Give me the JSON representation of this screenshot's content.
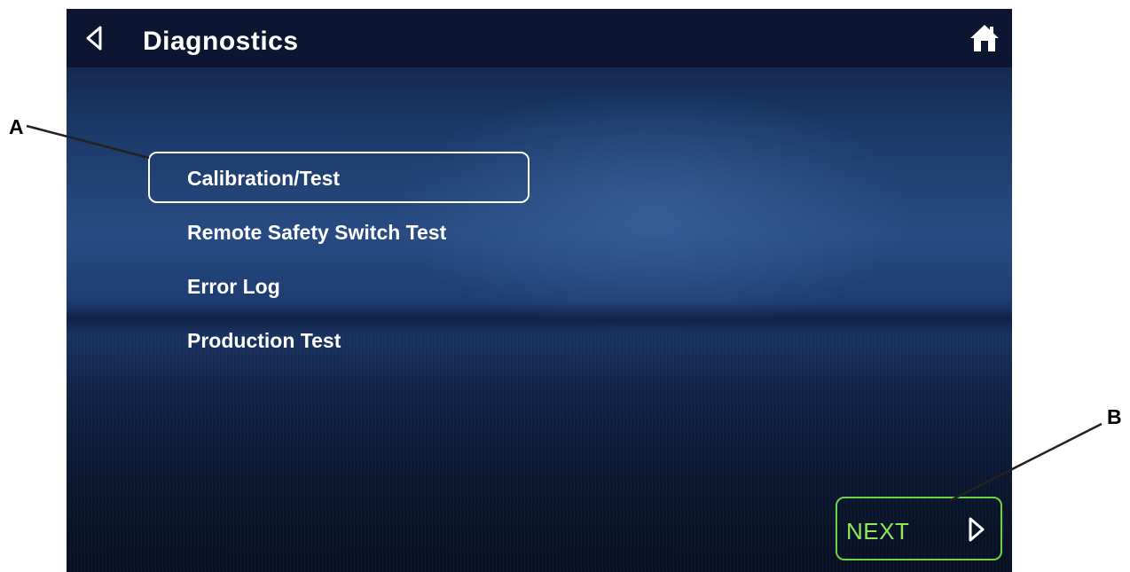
{
  "header": {
    "back_icon": "back-triangle-icon",
    "title": "Diagnostics",
    "home_icon": "home-icon"
  },
  "menu": {
    "items": [
      {
        "label": "Calibration/Test",
        "selected": true
      },
      {
        "label": "Remote Safety Switch Test",
        "selected": false
      },
      {
        "label": "Error Log",
        "selected": false
      },
      {
        "label": "Production Test",
        "selected": false
      }
    ]
  },
  "footer": {
    "next_label": "NEXT",
    "next_icon": "forward-triangle-icon"
  },
  "callouts": {
    "a": "A",
    "b": "B"
  },
  "colors": {
    "header_bg": "#0d1630",
    "next_accent": "#6fd34a",
    "text": "#ffffff"
  }
}
